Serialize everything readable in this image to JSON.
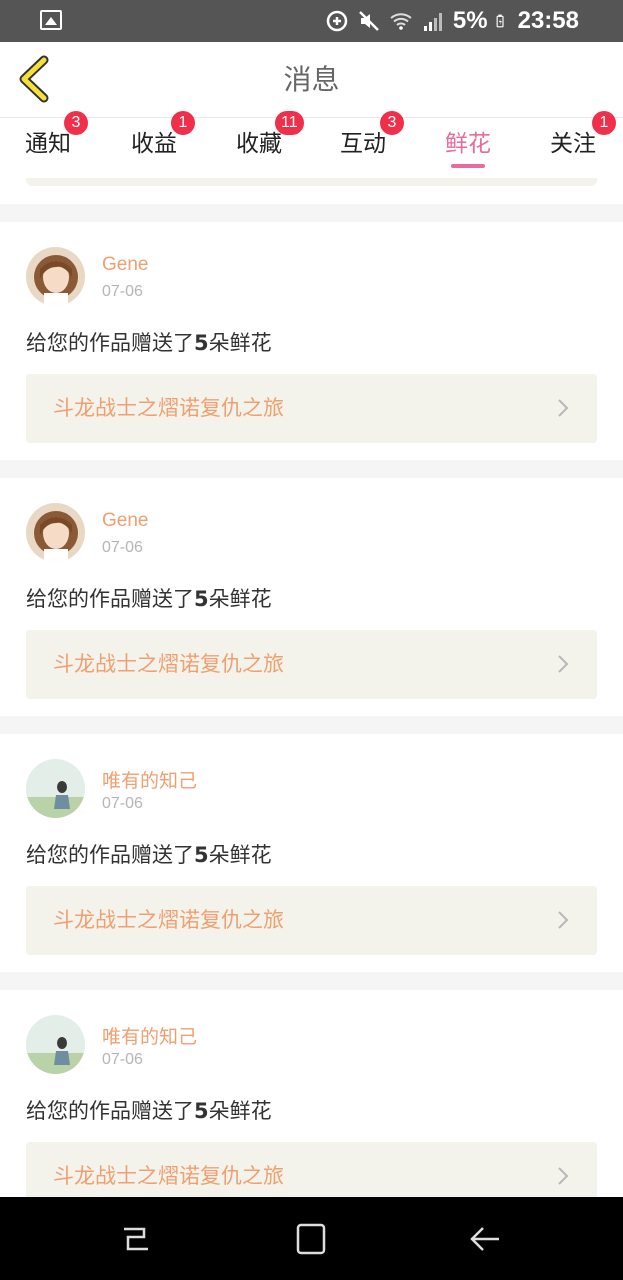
{
  "status_bar": {
    "battery": "5%",
    "time": "23:58",
    "icons": [
      "image-icon",
      "data-saver-icon",
      "mute-icon",
      "wifi-icon",
      "signal-icon",
      "battery-icon"
    ]
  },
  "header": {
    "title": "消息",
    "back_icon": "chevron-left-icon"
  },
  "tabs": [
    {
      "label": "通知",
      "badge": "3"
    },
    {
      "label": "收益",
      "badge": "1"
    },
    {
      "label": "收藏",
      "badge": "11"
    },
    {
      "label": "互动",
      "badge": "3"
    },
    {
      "label": "鲜花",
      "badge": "",
      "active": true
    },
    {
      "label": "关注",
      "badge": "1"
    }
  ],
  "messages": [
    {
      "user": "Gene",
      "date": "07-06",
      "msg_prefix": "给您的作品赠送了",
      "msg_count": "5",
      "msg_suffix": "朵鲜花",
      "work": "斗龙战士之熠诺复仇之旅"
    },
    {
      "user": "Gene",
      "date": "07-06",
      "msg_prefix": "给您的作品赠送了",
      "msg_count": "5",
      "msg_suffix": "朵鲜花",
      "work": "斗龙战士之熠诺复仇之旅"
    },
    {
      "user": "唯有的知己",
      "date": "07-06",
      "msg_prefix": "给您的作品赠送了",
      "msg_count": "5",
      "msg_suffix": "朵鲜花",
      "work": "斗龙战士之熠诺复仇之旅"
    },
    {
      "user": "唯有的知己",
      "date": "07-06",
      "msg_prefix": "给您的作品赠送了",
      "msg_count": "5",
      "msg_suffix": "朵鲜花",
      "work": "斗龙战士之熠诺复仇之旅"
    }
  ],
  "colors": {
    "accent_pink": "#e96a9c",
    "badge_red": "#f0304a",
    "name_orange": "#f0a070",
    "back_yellow": "#f5e03a"
  }
}
